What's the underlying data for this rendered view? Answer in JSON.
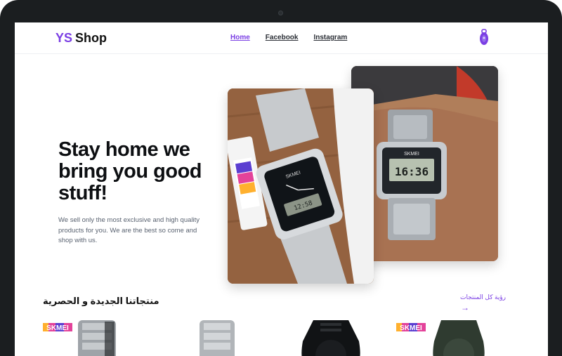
{
  "brand": {
    "prefix": "YS",
    "name": "Shop"
  },
  "nav": {
    "links": [
      {
        "label": "Home",
        "active": true
      },
      {
        "label": "Facebook",
        "active": false
      },
      {
        "label": "Instagram",
        "active": false
      }
    ]
  },
  "hero": {
    "title": "Stay home we bring you good stuff!",
    "text": "We sell only the most exclusive and high quality products for you. We are the best so come and shop with us."
  },
  "products": {
    "section_title": "منتجاتنا الجديدة و الحصرية",
    "view_all_label": "رؤية كل المنتجات",
    "cards": [
      {
        "has_brand_tag": true
      },
      {
        "has_brand_tag": false
      },
      {
        "has_brand_tag": false
      },
      {
        "has_brand_tag": true
      }
    ]
  },
  "colors": {
    "accent": "#7b3fe4",
    "text": "#0d0f12",
    "muted": "#596270"
  },
  "icons": {
    "cart": "shopping-bag-icon",
    "arrow": "arrow-right-icon"
  }
}
